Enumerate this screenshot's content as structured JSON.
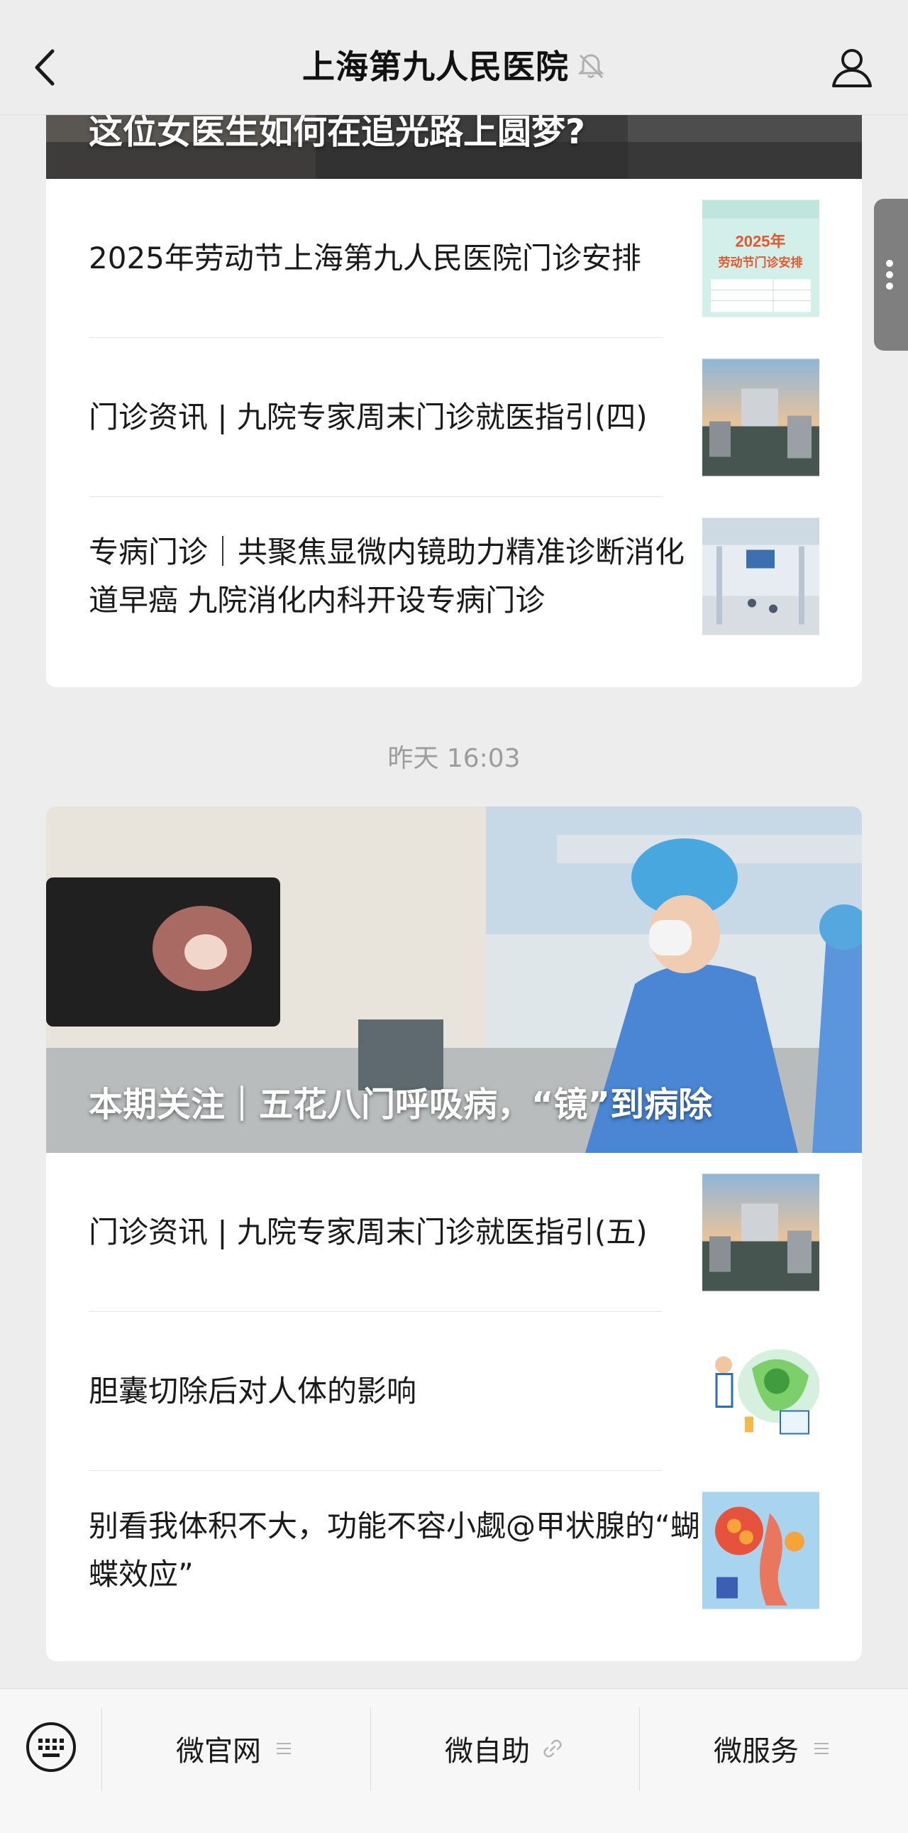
{
  "header": {
    "title": "上海第九人民医院",
    "back_icon": "chevron-left-icon",
    "mute_icon": "bell-muted-icon",
    "profile_icon": "person-icon"
  },
  "side_handle": {
    "icon": "more-vertical-icon"
  },
  "card1": {
    "cover_title": "这位女医生如何在追光路上圆梦?",
    "items": [
      {
        "title": "2025年劳动节上海第九人民医院门诊安排",
        "thumb_text_line1": "2025年",
        "thumb_text_line2": "劳动节门诊安排"
      },
      {
        "title": "门诊资讯 | 九院专家周末门诊就医指引(四)"
      },
      {
        "title": "专病门诊｜共聚焦显微内镜助力精准诊断消化道早癌 九院消化内科开设专病门诊"
      }
    ]
  },
  "timestamp": "昨天 16:03",
  "card2": {
    "cover_title": "本期关注｜五花八门呼吸病，“镜”到病除",
    "items": [
      {
        "title": "门诊资讯 | 九院专家周末门诊就医指引(五)"
      },
      {
        "title": "胆囊切除后对人体的影响"
      },
      {
        "title": "别看我体积不大，功能不容小觑@甲状腺的“蝴蝶效应”"
      }
    ]
  },
  "menu": {
    "keyboard_icon": "keyboard-icon",
    "items": [
      {
        "label": "微官网",
        "icon": "menu-lines-icon"
      },
      {
        "label": "微自助",
        "icon": "link-icon"
      },
      {
        "label": "微服务",
        "icon": "menu-lines-icon"
      }
    ]
  },
  "colors": {
    "background": "#ededed",
    "card": "#ffffff",
    "timestamp": "#9c9c9c",
    "handle": "#7f7f7f"
  }
}
